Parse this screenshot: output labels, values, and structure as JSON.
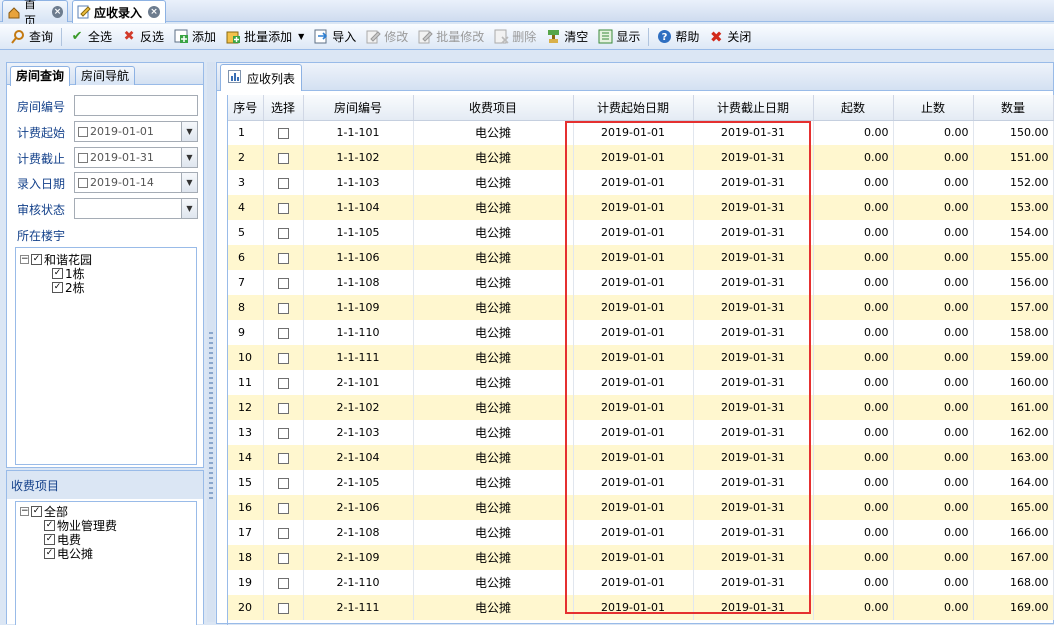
{
  "tabs": [
    {
      "label": "首页",
      "icon": "home-icon"
    },
    {
      "label": "应收录入",
      "icon": "edit-form-icon"
    }
  ],
  "toolbar": {
    "query": "查询",
    "select_all": "全选",
    "invert": "反选",
    "add": "添加",
    "batch_add": "批量添加",
    "import": "导入",
    "edit": "修改",
    "batch_edit": "批量修改",
    "delete": "删除",
    "clear": "清空",
    "display": "显示",
    "help": "帮助",
    "close": "关闭"
  },
  "left_panel": {
    "tab_room_query": "房间查询",
    "tab_room_nav": "房间导航",
    "room_no_label": "房间编号",
    "room_no_value": "",
    "start_label": "计费起始",
    "start_value": "2019-01-01",
    "end_label": "计费截止",
    "end_value": "2019-01-31",
    "entry_label": "录入日期",
    "entry_value": "2019-01-14",
    "audit_label": "审核状态",
    "audit_value": "",
    "building_label": "所在楼宇",
    "building_tree": {
      "root": "和谐花园",
      "children": [
        "1栋",
        "2栋"
      ]
    },
    "fee_label": "收费项目",
    "fee_tree": {
      "root": "全部",
      "children": [
        "物业管理费",
        "电费",
        "电公摊"
      ]
    }
  },
  "right_panel": {
    "tab_label": "应收列表",
    "columns": [
      "序号",
      "选择",
      "房间编号",
      "收费项目",
      "计费起始日期",
      "计费截止日期",
      "起数",
      "止数",
      "数量"
    ],
    "rows": [
      {
        "no": "1",
        "room": "1-1-101",
        "item": "电公摊",
        "start": "2019-01-01",
        "end": "2019-01-31",
        "from": "0.00",
        "to": "0.00",
        "qty": "150.00"
      },
      {
        "no": "2",
        "room": "1-1-102",
        "item": "电公摊",
        "start": "2019-01-01",
        "end": "2019-01-31",
        "from": "0.00",
        "to": "0.00",
        "qty": "151.00"
      },
      {
        "no": "3",
        "room": "1-1-103",
        "item": "电公摊",
        "start": "2019-01-01",
        "end": "2019-01-31",
        "from": "0.00",
        "to": "0.00",
        "qty": "152.00"
      },
      {
        "no": "4",
        "room": "1-1-104",
        "item": "电公摊",
        "start": "2019-01-01",
        "end": "2019-01-31",
        "from": "0.00",
        "to": "0.00",
        "qty": "153.00"
      },
      {
        "no": "5",
        "room": "1-1-105",
        "item": "电公摊",
        "start": "2019-01-01",
        "end": "2019-01-31",
        "from": "0.00",
        "to": "0.00",
        "qty": "154.00"
      },
      {
        "no": "6",
        "room": "1-1-106",
        "item": "电公摊",
        "start": "2019-01-01",
        "end": "2019-01-31",
        "from": "0.00",
        "to": "0.00",
        "qty": "155.00"
      },
      {
        "no": "7",
        "room": "1-1-108",
        "item": "电公摊",
        "start": "2019-01-01",
        "end": "2019-01-31",
        "from": "0.00",
        "to": "0.00",
        "qty": "156.00"
      },
      {
        "no": "8",
        "room": "1-1-109",
        "item": "电公摊",
        "start": "2019-01-01",
        "end": "2019-01-31",
        "from": "0.00",
        "to": "0.00",
        "qty": "157.00"
      },
      {
        "no": "9",
        "room": "1-1-110",
        "item": "电公摊",
        "start": "2019-01-01",
        "end": "2019-01-31",
        "from": "0.00",
        "to": "0.00",
        "qty": "158.00"
      },
      {
        "no": "10",
        "room": "1-1-111",
        "item": "电公摊",
        "start": "2019-01-01",
        "end": "2019-01-31",
        "from": "0.00",
        "to": "0.00",
        "qty": "159.00"
      },
      {
        "no": "11",
        "room": "2-1-101",
        "item": "电公摊",
        "start": "2019-01-01",
        "end": "2019-01-31",
        "from": "0.00",
        "to": "0.00",
        "qty": "160.00"
      },
      {
        "no": "12",
        "room": "2-1-102",
        "item": "电公摊",
        "start": "2019-01-01",
        "end": "2019-01-31",
        "from": "0.00",
        "to": "0.00",
        "qty": "161.00"
      },
      {
        "no": "13",
        "room": "2-1-103",
        "item": "电公摊",
        "start": "2019-01-01",
        "end": "2019-01-31",
        "from": "0.00",
        "to": "0.00",
        "qty": "162.00"
      },
      {
        "no": "14",
        "room": "2-1-104",
        "item": "电公摊",
        "start": "2019-01-01",
        "end": "2019-01-31",
        "from": "0.00",
        "to": "0.00",
        "qty": "163.00"
      },
      {
        "no": "15",
        "room": "2-1-105",
        "item": "电公摊",
        "start": "2019-01-01",
        "end": "2019-01-31",
        "from": "0.00",
        "to": "0.00",
        "qty": "164.00"
      },
      {
        "no": "16",
        "room": "2-1-106",
        "item": "电公摊",
        "start": "2019-01-01",
        "end": "2019-01-31",
        "from": "0.00",
        "to": "0.00",
        "qty": "165.00"
      },
      {
        "no": "17",
        "room": "2-1-108",
        "item": "电公摊",
        "start": "2019-01-01",
        "end": "2019-01-31",
        "from": "0.00",
        "to": "0.00",
        "qty": "166.00"
      },
      {
        "no": "18",
        "room": "2-1-109",
        "item": "电公摊",
        "start": "2019-01-01",
        "end": "2019-01-31",
        "from": "0.00",
        "to": "0.00",
        "qty": "167.00"
      },
      {
        "no": "19",
        "room": "2-1-110",
        "item": "电公摊",
        "start": "2019-01-01",
        "end": "2019-01-31",
        "from": "0.00",
        "to": "0.00",
        "qty": "168.00"
      },
      {
        "no": "20",
        "room": "2-1-111",
        "item": "电公摊",
        "start": "2019-01-01",
        "end": "2019-01-31",
        "from": "0.00",
        "to": "0.00",
        "qty": "169.00"
      }
    ]
  },
  "colors": {
    "alt_row": "#fff7cf",
    "highlight_box": "#e53030",
    "panel_border": "#99bbe8",
    "label_blue": "#15428b"
  }
}
